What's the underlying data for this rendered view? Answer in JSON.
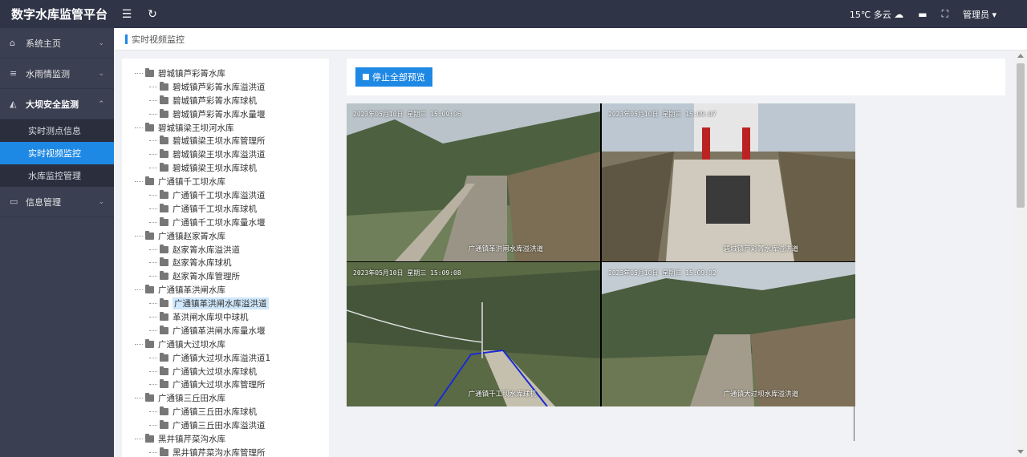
{
  "app": {
    "title": "数字水库监管平台"
  },
  "topbar": {
    "weather": "15℃ 多云",
    "user": "管理员"
  },
  "sidebar": {
    "items": [
      {
        "label": "系统主页",
        "icon": "home-icon"
      },
      {
        "label": "水雨情监测",
        "icon": "list-icon"
      },
      {
        "label": "大坝安全监测",
        "icon": "area-chart-icon"
      },
      {
        "label": "信息管理",
        "icon": "monitor-icon"
      }
    ],
    "submenu": [
      "实时测点信息",
      "实时视频监控",
      "水库监控管理"
    ]
  },
  "breadcrumb": "实时视频监控",
  "tree": [
    {
      "label": "碧城镇芦彩箐水库",
      "level": 0
    },
    {
      "label": "碧城镇芦彩箐水库溢洪道",
      "level": 1
    },
    {
      "label": "碧城镇芦彩箐水库球机",
      "level": 1
    },
    {
      "label": "碧城镇芦彩箐水库水量堰",
      "level": 1
    },
    {
      "label": "碧城镇梁王坝河水库",
      "level": 0
    },
    {
      "label": "碧城镇梁王坝水库管理所",
      "level": 1
    },
    {
      "label": "碧城镇梁王坝水库溢洪道",
      "level": 1
    },
    {
      "label": "碧城镇梁王坝水库球机",
      "level": 1
    },
    {
      "label": "广通镇千工坝水库",
      "level": 0
    },
    {
      "label": "广通镇千工坝水库溢洪道",
      "level": 1
    },
    {
      "label": "广通镇千工坝水库球机",
      "level": 1
    },
    {
      "label": "广通镇千工坝水库量水堰",
      "level": 1
    },
    {
      "label": "广通镇赵家箐水库",
      "level": 0
    },
    {
      "label": "赵家箐水库溢洪道",
      "level": 1
    },
    {
      "label": "赵家箐水库球机",
      "level": 1
    },
    {
      "label": "赵家箐水库管理所",
      "level": 1
    },
    {
      "label": "广通镇革洪闸水库",
      "level": 0
    },
    {
      "label": "广通镇革洪闸水库溢洪道",
      "level": 1,
      "selected": true
    },
    {
      "label": "革洪闸水库坝中球机",
      "level": 1
    },
    {
      "label": "广通镇革洪闸水库量水堰",
      "level": 1
    },
    {
      "label": "广通镇大过坝水库",
      "level": 0
    },
    {
      "label": "广通镇大过坝水库溢洪道1",
      "level": 1
    },
    {
      "label": "广通镇大过坝水库球机",
      "level": 1
    },
    {
      "label": "广通镇大过坝水库管理所",
      "level": 1
    },
    {
      "label": "广通镇三丘田水库",
      "level": 0
    },
    {
      "label": "广通镇三丘田水库球机",
      "level": 1
    },
    {
      "label": "广通镇三丘田水库溢洪道",
      "level": 1
    },
    {
      "label": "黑井镇芹菜沟水库",
      "level": 0
    },
    {
      "label": "黑井镇芹菜沟水库管理所",
      "level": 1
    }
  ],
  "toolbar": {
    "stop_all": "停止全部预览"
  },
  "videos": [
    {
      "timestamp": "2023年05月10日 星期三 15:09:06",
      "camera": "广通镇革洪闸水库溢洪道"
    },
    {
      "timestamp": "2023年05月10日 星期三 15:09:07",
      "camera": "碧城镇芦彩箐水库溢洪道"
    },
    {
      "timestamp": "2023年05月10日 星期三 15:09:08",
      "camera": "广通镇千工坝水库球机"
    },
    {
      "timestamp": "2023年05月10日 星期三 15:09:02",
      "camera": "广通镇大过坝水库溢洪道"
    }
  ]
}
